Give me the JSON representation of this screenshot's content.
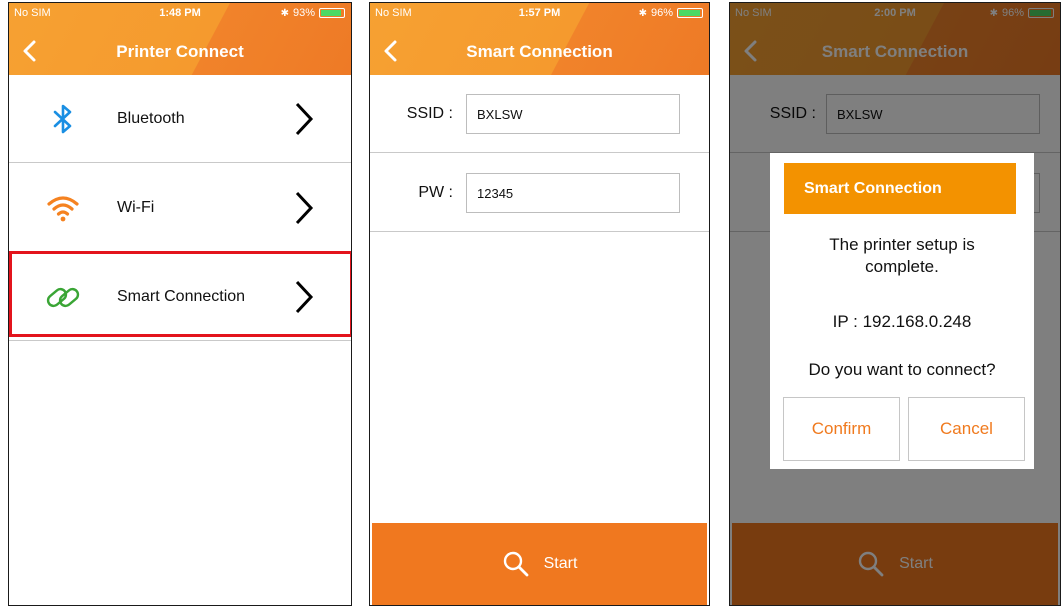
{
  "screens": [
    {
      "status": {
        "carrier": "No SIM",
        "time": "1:48 PM",
        "battery": "93%",
        "battery_level": 0.93
      },
      "title": "Printer Connect",
      "items": [
        {
          "label": "Bluetooth",
          "icon": "bluetooth-icon"
        },
        {
          "label": "Wi-Fi",
          "icon": "wifi-icon"
        },
        {
          "label": "Smart Connection",
          "icon": "link-icon"
        }
      ]
    },
    {
      "status": {
        "carrier": "No SIM",
        "time": "1:57 PM",
        "battery": "96%",
        "battery_level": 0.96
      },
      "title": "Smart Connection",
      "form": {
        "ssid_label": "SSID :",
        "ssid_value": "BXLSW",
        "pw_label": "PW :",
        "pw_value": "12345"
      },
      "start_label": "Start"
    },
    {
      "status": {
        "carrier": "No SIM",
        "time": "2:00 PM",
        "battery": "96%",
        "battery_level": 0.96
      },
      "title": "Smart Connection",
      "form": {
        "ssid_label": "SSID :",
        "ssid_value": "BXLSW"
      },
      "start_label": "Start",
      "dialog": {
        "title": "Smart Connection",
        "message_line1": "The printer setup is",
        "message_line2": "complete.",
        "ip": "IP : 192.168.0.248",
        "question": "Do you want to connect?",
        "confirm": "Confirm",
        "cancel": "Cancel"
      }
    }
  ],
  "colors": {
    "header": "#f59a2e",
    "start": "#f0781f",
    "dialog_head": "#f39200",
    "highlight": "#e3141c",
    "bluetooth": "#1a8fe3",
    "wifi": "#f58220",
    "link": "#3aa535"
  }
}
